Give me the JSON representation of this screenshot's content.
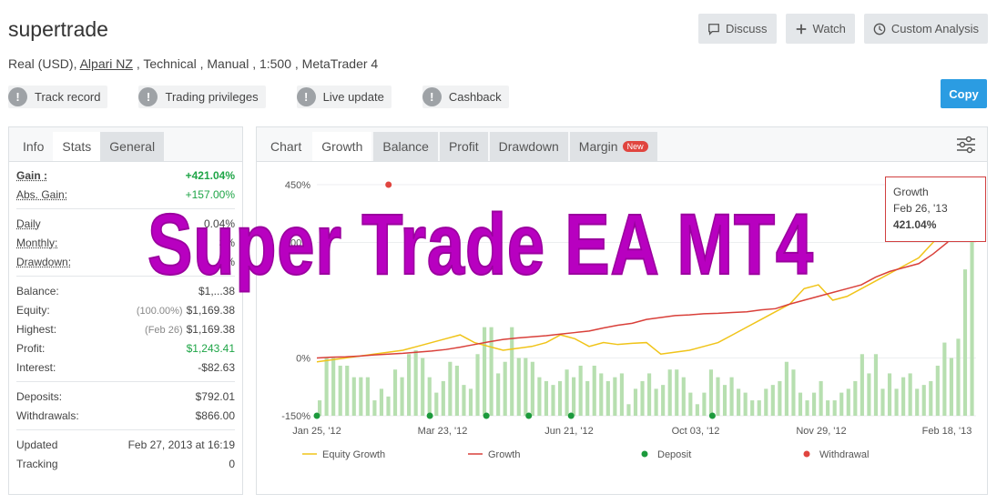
{
  "header": {
    "title": "supertrade",
    "subtitle_pre": "Real (USD), ",
    "broker": "Alpari NZ",
    "subtitle_post": " , Technical , Manual , 1:500 , MetaTrader 4",
    "buttons": {
      "discuss": "Discuss",
      "watch": "Watch",
      "custom_analysis": "Custom Analysis",
      "copy": "Copy"
    },
    "features": [
      "Track record",
      "Trading privileges",
      "Live update",
      "Cashback"
    ]
  },
  "left_panel": {
    "tabs": [
      "Info",
      "Stats",
      "General"
    ],
    "active_tab": "Stats",
    "groups": [
      [
        {
          "label": "Gain :",
          "value": "+421.04%",
          "style": "gain"
        },
        {
          "label": "Abs. Gain:",
          "value": "+157.00%",
          "style": "green"
        }
      ],
      [
        {
          "label": "Daily",
          "value": "0.04%",
          "style": "und"
        },
        {
          "label": "Monthly:",
          "value": "3%",
          "style": "und"
        },
        {
          "label": "Drawdown:",
          "value": "%",
          "style": "plain"
        }
      ],
      [
        {
          "label": "Balance:",
          "value": "$1,...38",
          "style": "plain"
        },
        {
          "label": "Equity:",
          "prefix": "(100.00%)",
          "value": "$1,169.38",
          "style": "plain"
        },
        {
          "label": "Highest:",
          "prefix": "(Feb 26)",
          "value": "$1,169.38",
          "style": "plain"
        },
        {
          "label": "Profit:",
          "value": "$1,243.41",
          "style": "green"
        },
        {
          "label": "Interest:",
          "value": "-$82.63",
          "style": "plain"
        }
      ],
      [
        {
          "label": "Deposits:",
          "value": "$792.01",
          "style": "plain"
        },
        {
          "label": "Withdrawals:",
          "value": "$866.00",
          "style": "plain"
        }
      ],
      [
        {
          "label": "Updated",
          "value": "Feb 27, 2013 at 16:19",
          "style": "plain"
        },
        {
          "label": "Tracking",
          "value": "0",
          "style": "plain"
        }
      ]
    ]
  },
  "right_panel": {
    "tabs": [
      "Chart",
      "Growth",
      "Balance",
      "Profit",
      "Drawdown",
      "Margin"
    ],
    "active_tab": "Growth",
    "new_badge": "New",
    "tooltip": {
      "label": "Growth",
      "date": "Feb 26, '13",
      "value": "421.04%"
    }
  },
  "watermark": "Super Trade EA MT4",
  "colors": {
    "accent": "#2b9ce2",
    "green": "#1fa547",
    "growth_line": "#d9403a",
    "equity_line": "#f0c419",
    "bars": "#b7dfb0",
    "deposit": "#1c9a3c",
    "withdrawal": "#e0453f",
    "watermark": "#b800c0"
  },
  "chart_data": {
    "type": "line",
    "y_ticks": [
      "450%",
      "300%",
      "0%",
      "-150%"
    ],
    "x_ticks": [
      "Jan 25, '12",
      "Mar 23, '12",
      "Jun 21, '12",
      "Oct 03, '12",
      "Nov 29, '12",
      "Feb 18, '13"
    ],
    "ylim": [
      -150,
      450
    ],
    "legend": [
      "Equity Growth",
      "Growth",
      "Deposit",
      "Withdrawal"
    ],
    "growth": [
      0,
      2,
      3,
      5,
      8,
      10,
      12,
      15,
      18,
      22,
      28,
      35,
      42,
      48,
      52,
      55,
      58,
      62,
      66,
      70,
      78,
      85,
      90,
      100,
      105,
      110,
      112,
      115,
      116,
      118,
      120,
      125,
      128,
      140,
      150,
      160,
      170,
      180,
      190,
      210,
      225,
      235,
      245,
      270,
      300,
      350,
      421
    ],
    "equity": [
      -10,
      -5,
      0,
      5,
      10,
      15,
      20,
      30,
      40,
      50,
      60,
      40,
      30,
      20,
      25,
      30,
      40,
      60,
      50,
      30,
      40,
      35,
      38,
      40,
      10,
      15,
      20,
      30,
      40,
      60,
      80,
      100,
      120,
      140,
      180,
      190,
      150,
      160,
      180,
      200,
      220,
      240,
      260,
      300,
      340,
      380,
      421
    ],
    "bars": [
      40,
      150,
      150,
      130,
      130,
      100,
      100,
      100,
      40,
      70,
      50,
      120,
      100,
      160,
      170,
      150,
      100,
      60,
      90,
      140,
      130,
      80,
      70,
      160,
      230,
      230,
      110,
      140,
      230,
      150,
      150,
      140,
      100,
      90,
      80,
      90,
      120,
      100,
      130,
      90,
      130,
      110,
      90,
      100,
      110,
      30,
      70,
      90,
      110,
      70,
      80,
      120,
      120,
      100,
      60,
      30,
      60,
      120,
      100,
      80,
      100,
      70,
      60,
      40,
      40,
      70,
      80,
      90,
      140,
      120,
      60,
      40,
      60,
      90,
      40,
      40,
      60,
      70,
      90,
      160,
      110,
      160,
      70,
      110,
      70,
      100,
      110,
      70,
      80,
      90,
      130,
      190,
      150,
      200,
      380,
      520
    ],
    "deposits_idx": [
      0,
      8,
      12,
      15,
      18,
      28
    ],
    "withdrawals_idx": [
      5,
      44,
      45
    ]
  }
}
